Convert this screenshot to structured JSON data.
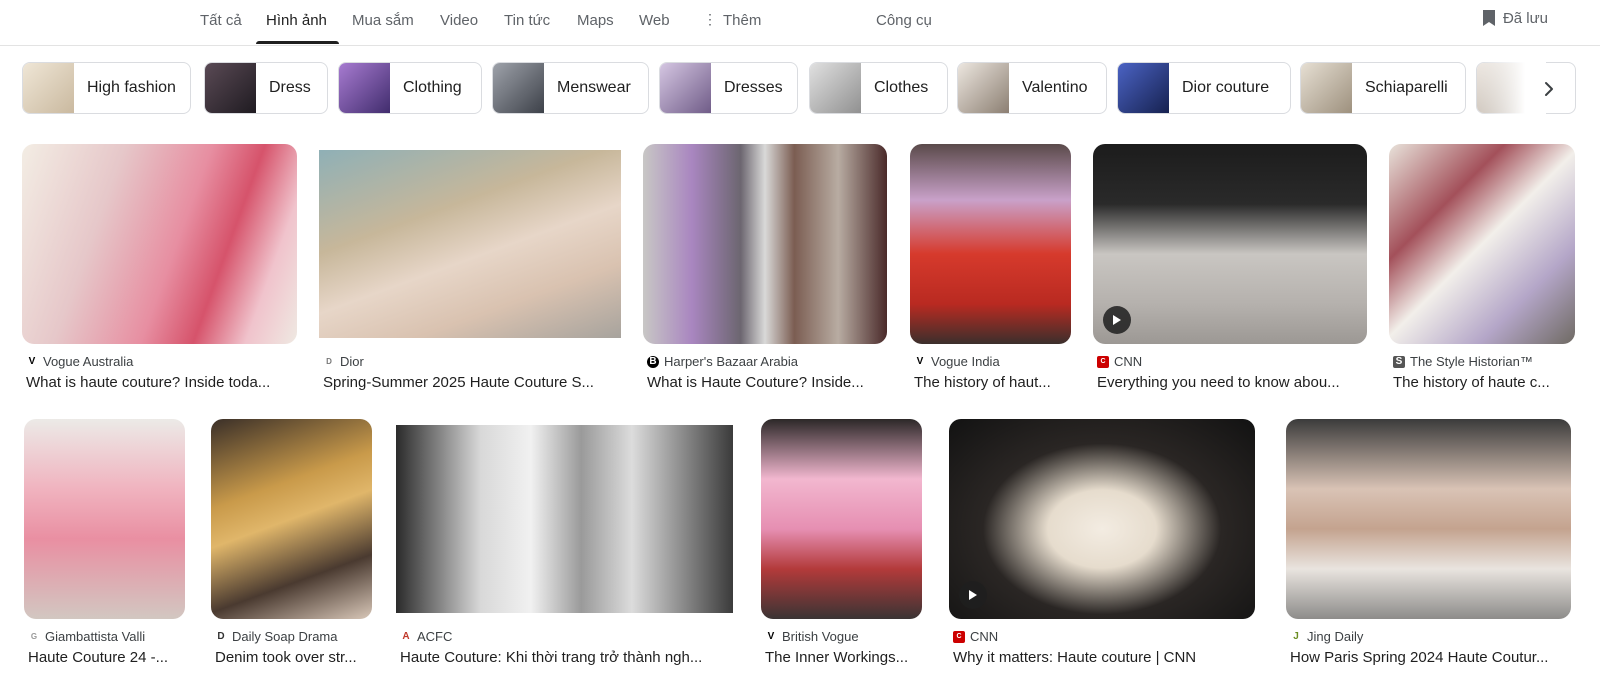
{
  "tabs": {
    "all": "Tất cả",
    "images": "Hình ảnh",
    "shopping": "Mua sắm",
    "video": "Video",
    "news": "Tin tức",
    "maps": "Maps",
    "web": "Web",
    "more": "Thêm",
    "tools": "Công cụ",
    "saved": "Đã lưu"
  },
  "chips": [
    {
      "label": "High fashion",
      "color": "#e8dcc8"
    },
    {
      "label": "Dress",
      "color": "#3b2f3a"
    },
    {
      "label": "Clothing",
      "color": "#7a4fa3"
    },
    {
      "label": "Menswear",
      "color": "#6b6f78"
    },
    {
      "label": "Dresses",
      "color": "#b9a6c9"
    },
    {
      "label": "Clothes",
      "color": "#bdbdbd"
    },
    {
      "label": "Valentino",
      "color": "#d8d0c8"
    },
    {
      "label": "Dior couture",
      "color": "#2b3f8a"
    },
    {
      "label": "Schiaparelli",
      "color": "#cfc6b8"
    },
    {
      "label": "",
      "color": "#d9d1c9"
    }
  ],
  "results": {
    "row1": [
      {
        "source": "Vogue Australia",
        "title": "What is haute couture? Inside toda...",
        "favicon": "V",
        "video": false
      },
      {
        "source": "Dior",
        "title": "Spring-Summer 2025 Haute Couture S...",
        "favicon": "D",
        "video": false
      },
      {
        "source": "Harper's Bazaar Arabia",
        "title": "What is Haute Couture? Inside...",
        "favicon": "B",
        "video": false
      },
      {
        "source": "Vogue India",
        "title": "The history of haut...",
        "favicon": "V",
        "video": false
      },
      {
        "source": "CNN",
        "title": "Everything you need to know abou...",
        "favicon": "C",
        "video": true
      },
      {
        "source": "The Style Historian™",
        "title": "The history of haute c...",
        "favicon": "S",
        "video": false
      }
    ],
    "row2": [
      {
        "source": "Giambattista Valli",
        "title": "Haute Couture 24 -...",
        "favicon": "G",
        "video": false
      },
      {
        "source": "Daily Soap Drama",
        "title": "Denim took over str...",
        "favicon": "D",
        "video": false
      },
      {
        "source": "ACFC",
        "title": "Haute Couture: Khi thời trang trở thành ngh...",
        "favicon": "A",
        "video": false
      },
      {
        "source": "British Vogue",
        "title": "The Inner Workings...",
        "favicon": "V",
        "video": false
      },
      {
        "source": "CNN",
        "title": "Why it matters: Haute couture | CNN",
        "favicon": "C",
        "video": true
      },
      {
        "source": "Jing Daily",
        "title": "How Paris Spring 2024 Haute Coutur...",
        "favicon": "J",
        "video": false
      }
    ]
  },
  "colors": {
    "text_primary": "#1f1f1f",
    "text_secondary": "#5f6368",
    "border": "#dadce0",
    "cnn_red": "#cc0000"
  }
}
